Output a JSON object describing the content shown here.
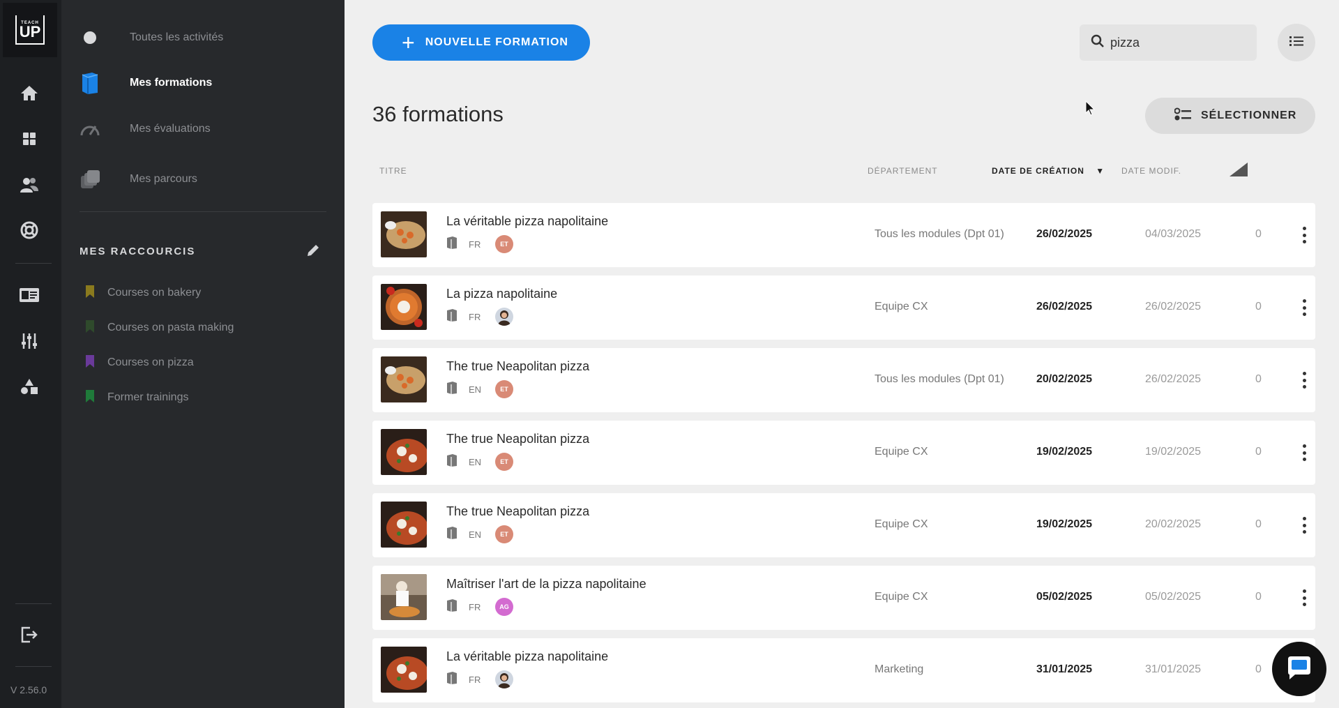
{
  "app": {
    "version": "V 2.56.0",
    "logo_top": "TEACH",
    "logo_main": "UP"
  },
  "rail": {
    "icons": [
      "home-icon",
      "dashboard-icon",
      "users-icon",
      "support-icon",
      "id-card-icon",
      "settings-sliders-icon",
      "shapes-icon",
      "logout-icon"
    ]
  },
  "sidebar": {
    "nav": [
      {
        "label": "Toutes les activités",
        "icon": "circle-icon"
      },
      {
        "label": "Mes formations",
        "icon": "book-icon",
        "active": true
      },
      {
        "label": "Mes évaluations",
        "icon": "gauge-icon"
      },
      {
        "label": "Mes parcours",
        "icon": "stack-icon"
      }
    ],
    "shortcuts_title": "MES RACCOURCIS",
    "shortcuts": [
      {
        "label": "Courses on bakery",
        "color": "#8a7a1e"
      },
      {
        "label": "Courses on pasta making",
        "color": "#2f4a2c"
      },
      {
        "label": "Courses on pizza",
        "color": "#6a3a9a"
      },
      {
        "label": "Former trainings",
        "color": "#1f7a3a"
      }
    ]
  },
  "toolbar": {
    "new_label": "NOUVELLE FORMATION",
    "search_value": "pizza",
    "select_label": "SÉLECTIONNER"
  },
  "list": {
    "count_title": "36 formations",
    "columns": {
      "title": "TITRE",
      "department": "DÉPARTEMENT",
      "created": "DATE DE CRÉATION",
      "modified": "DATE MODIF."
    },
    "sort_indicator": "▼",
    "rows": [
      {
        "title": "La véritable pizza napolitaine",
        "lang": "FR",
        "author": "ET",
        "department": "Tous les modules (Dpt 01)",
        "created": "26/02/2025",
        "modified": "04/03/2025",
        "count": "0"
      },
      {
        "title": "La pizza napolitaine",
        "lang": "FR",
        "author": "",
        "department": "Equipe CX",
        "created": "26/02/2025",
        "modified": "26/02/2025",
        "count": "0"
      },
      {
        "title": "The true Neapolitan pizza",
        "lang": "EN",
        "author": "ET",
        "department": "Tous les modules (Dpt 01)",
        "created": "20/02/2025",
        "modified": "26/02/2025",
        "count": "0"
      },
      {
        "title": "The true Neapolitan pizza",
        "lang": "EN",
        "author": "ET",
        "department": "Equipe CX",
        "created": "19/02/2025",
        "modified": "19/02/2025",
        "count": "0"
      },
      {
        "title": "The true Neapolitan pizza",
        "lang": "EN",
        "author": "ET",
        "department": "Equipe CX",
        "created": "19/02/2025",
        "modified": "20/02/2025",
        "count": "0"
      },
      {
        "title": "Maîtriser l'art de la pizza napolitaine",
        "lang": "FR",
        "author": "AG",
        "department": "Equipe CX",
        "created": "05/02/2025",
        "modified": "05/02/2025",
        "count": "0"
      },
      {
        "title": "La véritable pizza napolitaine",
        "lang": "FR",
        "author": "",
        "department": "Marketing",
        "created": "31/01/2025",
        "modified": "31/01/2025",
        "count": "0"
      }
    ]
  },
  "colors": {
    "accent": "#1a82e6",
    "rail": "#1d1f22",
    "sidebar": "#27292c"
  }
}
